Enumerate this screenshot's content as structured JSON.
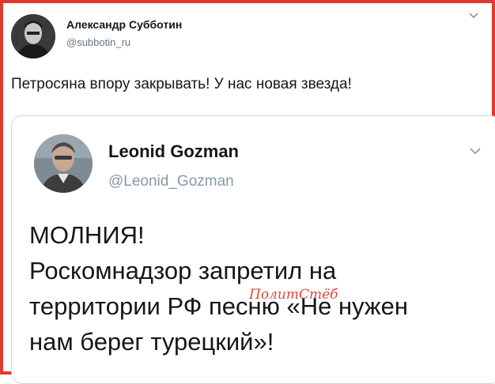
{
  "outer_tweet": {
    "author_name": "Александр Субботин",
    "author_handle": "@subbotin_ru",
    "avatar_icon": "user-avatar",
    "text": "Петросяна впору закрывать! У нас новая звезда!"
  },
  "quoted_tweet": {
    "author_name": "Leonid Gozman",
    "author_handle": "@Leonid_Gozman",
    "avatar_icon": "user-avatar",
    "menu_icon": "chevron-down-icon",
    "text_lines": [
      "МОЛНИЯ!",
      "Роскомнадзор запретил на",
      "территории РФ песню «Не нужен",
      "нам берег турецкий»!"
    ]
  },
  "watermark": "ПолитСтёб",
  "colors": {
    "frame_border": "#e03a2e",
    "name_text": "#14171a",
    "handle_text": "#657786",
    "card_border": "#ccd6dd",
    "watermark": "#d9322a"
  }
}
